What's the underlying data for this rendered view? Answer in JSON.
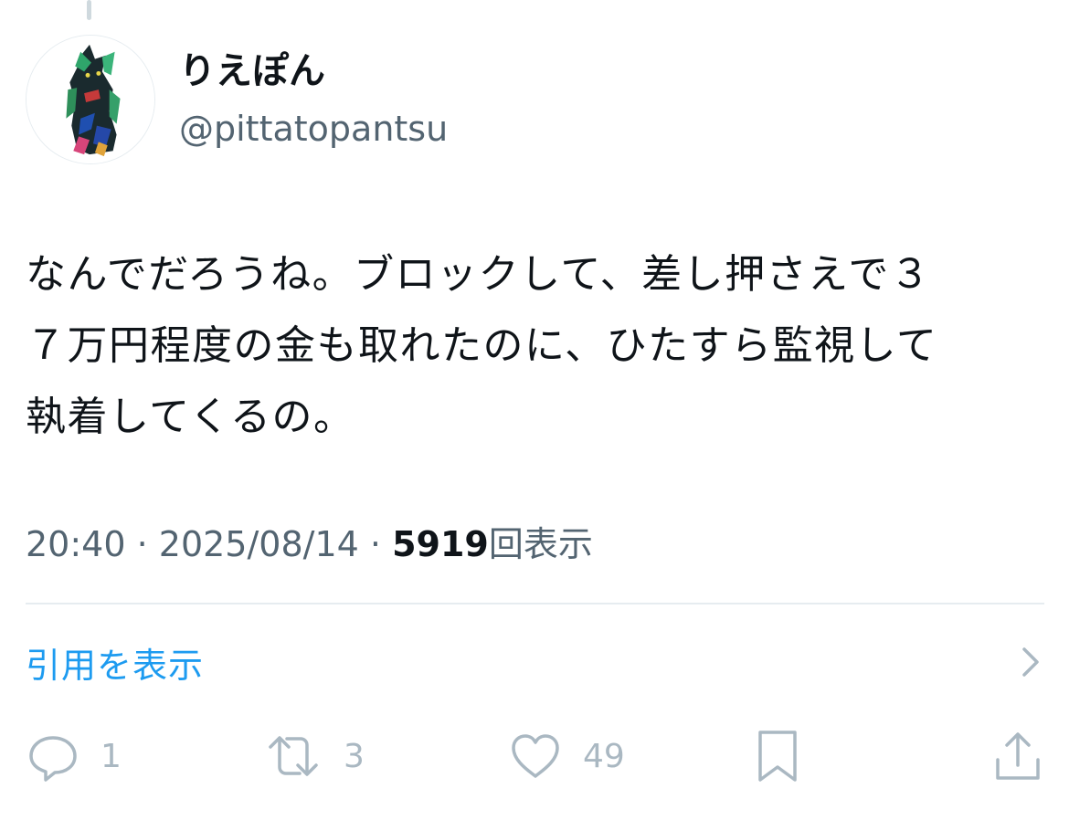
{
  "author": {
    "display_name": "りえぽん",
    "handle": "@pittatopantsu",
    "avatar_icon": "black-cat-painting-avatar"
  },
  "tweet": {
    "lines": [
      "なんでだろうね。ブロックして、差し押さえで３",
      "７万円程度の金も取れたのに、ひたすら監視して",
      "執着してくるの。"
    ]
  },
  "meta": {
    "time": "20:40",
    "separator": "·",
    "date": "2025/08/14",
    "views_count": "5919",
    "views_label": "回表示"
  },
  "quotes": {
    "label": "引用を表示",
    "icon": "chevron-right-icon"
  },
  "actions": {
    "reply": {
      "icon": "reply-icon",
      "count": "1"
    },
    "retweet": {
      "icon": "retweet-icon",
      "count": "3"
    },
    "like": {
      "icon": "heart-icon",
      "count": "49"
    },
    "bookmark": {
      "icon": "bookmark-icon"
    },
    "share": {
      "icon": "share-icon"
    }
  },
  "colors": {
    "text": "#0f1419",
    "secondary": "#536471",
    "accent": "#1d9bf0",
    "action_gray": "#aab8c2",
    "divider": "#e6ecf0"
  }
}
